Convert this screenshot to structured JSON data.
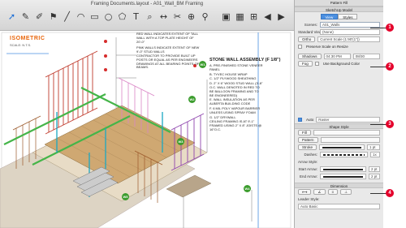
{
  "window": {
    "title": "Framing Documents.layout - A01_Wall_BM Framing"
  },
  "toolbar": {
    "tools": [
      {
        "icon": "select-arrow-icon",
        "glyph": "➚"
      },
      {
        "icon": "eraser-icon",
        "glyph": "✎"
      },
      {
        "icon": "style-eyedropper-icon",
        "glyph": "✐"
      },
      {
        "icon": "paint-bucket-icon",
        "glyph": "⚑"
      },
      {
        "icon": "line-icon",
        "glyph": "╱"
      },
      {
        "icon": "arc-icon",
        "glyph": "◠"
      },
      {
        "icon": "rectangle-icon",
        "glyph": "▭"
      },
      {
        "icon": "circle-icon",
        "glyph": "○"
      },
      {
        "icon": "polygon-icon",
        "glyph": "⬠"
      },
      {
        "icon": "text-icon",
        "glyph": "T"
      },
      {
        "icon": "label-icon",
        "glyph": "⌕"
      },
      {
        "icon": "dimension-icon",
        "glyph": "↔"
      },
      {
        "icon": "split-icon",
        "glyph": "✂"
      },
      {
        "icon": "join-icon",
        "glyph": "⊕"
      },
      {
        "icon": "zoom-icon",
        "glyph": "⚲"
      }
    ],
    "right_tools": [
      {
        "icon": "screen-icon",
        "glyph": "▣"
      },
      {
        "icon": "presentation-icon",
        "glyph": "▦"
      },
      {
        "icon": "add-page-icon",
        "glyph": "⊞"
      },
      {
        "icon": "prev-page-icon",
        "glyph": "◀"
      },
      {
        "icon": "next-page-icon",
        "glyph": "▶"
      }
    ]
  },
  "drawing": {
    "iso_title": "ISOMETRIC",
    "iso_scale": "SCALE: N.T.S.",
    "notes": [
      {
        "id": "note-red-wall",
        "text": "RED WALL INDICATES EXTENT OF TALL WALL WITH A TOP PLATE HEIGHT OF 20'-0\""
      },
      {
        "id": "note-pink-walls",
        "text": "PINK WALLS INDICATE EXTENT OF NEW 9'-0\" STUD WALLS"
      },
      {
        "id": "note-contractor",
        "text": "CONTRACTOR TO PROVIDE BUILT UP POSTS OR EQUAL AS PER ENGINEERS DRAWINGS AT ALL BEARING POINTS OF BEAMS."
      }
    ],
    "assembly_title": "STONE WALL ASSEMBLY (F 1/8\")",
    "assembly_lines": [
      "A. PRE-FINISHED STONE VENEER PANEL",
      "B. TYVEC HOUSE WRAP",
      "C. 1/2\" PLYWOOD SHEATHING",
      "D. 2\" X 6\" WOOD STUD WALL (3'-8\" O.C. WALL DENOTED IN RED TO BE BALLOON FRAMING AND TO BE ENGINEERED)",
      "E. WALL INSULATION AS PER ALBERTA BUILDING CODE",
      "F. 6 MIL POLY VAPOUR BARRIER UNLESS USING SPRAY FOAM",
      "G. 1/2\" DRYWALL",
      "CEILING FRAMING IS AT 9'-1\" FRAMED USING 2\" X 8\" JOISTS @ 16\"O.C."
    ],
    "tags": [
      "W1",
      "W2",
      "W3",
      "W4",
      "W5"
    ]
  },
  "panel": {
    "header": "Pattern Fill",
    "section_model": "SketchUp Model",
    "tabs": [
      "View",
      "Styles"
    ],
    "active_tab": "View",
    "scene_label": "Scenes:",
    "scene_value": "A01_Walls",
    "standard_views_label": "Standard Views:",
    "standard_views_value": "(None)",
    "ortho_label": "Ortho",
    "ortho_scale_value": "Current Scale (1:90'(1\"))",
    "preserve_scale": "Preserve Scale on Resize",
    "shadows_label": "Shadows",
    "shadows_time": "04:30 PM",
    "shadows_date": "08/30",
    "fog_label": "Fog",
    "use_bg_color": "Use Background Color",
    "auto_label": "Auto",
    "render_value": "Raster",
    "section_shape": "Shape Style",
    "fill_label": "Fill",
    "pattern_label": "Pattern",
    "stroke_label": "Stroke",
    "stroke_width": "1 pt",
    "dashes_label": "Dashes:",
    "dashes_value": "1x",
    "arrow_style_label": "Arrow Style:",
    "start_arrow_label": "Start Arrow:",
    "start_arrow_value": "2 pt",
    "end_arrow_label": "End Arrow:",
    "end_arrow_value": "2 pt",
    "section_dimension": "Dimension",
    "leader_style_label": "Leader Style:",
    "leader_style_value": "Auto Basic",
    "colors": {
      "accent": "#4a8fe0",
      "callout": "#e4002b"
    }
  },
  "callouts": [
    "1",
    "2",
    "3",
    "4"
  ]
}
